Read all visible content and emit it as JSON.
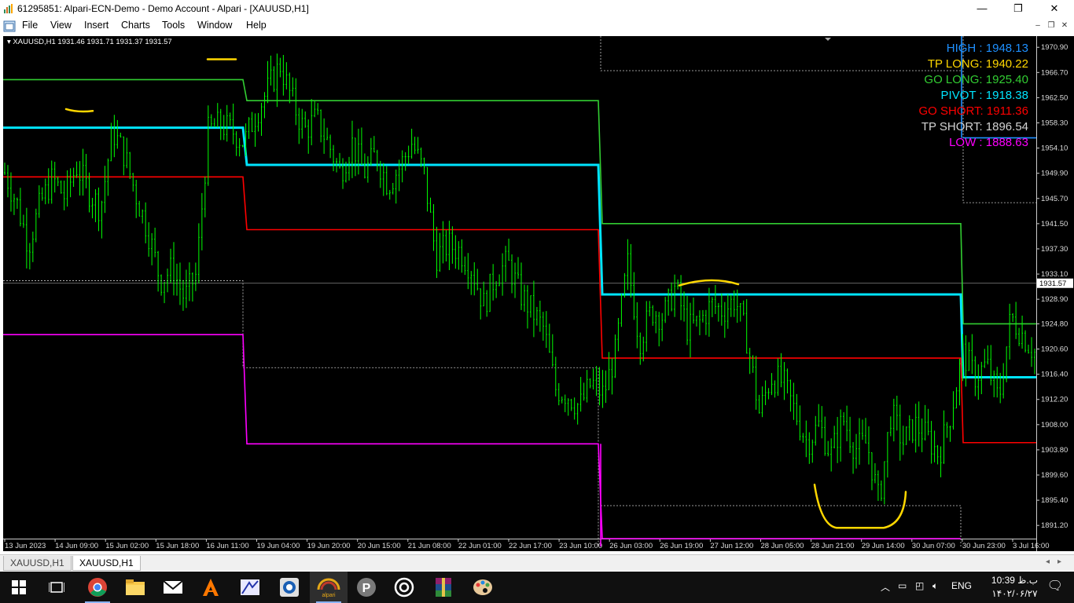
{
  "window": {
    "title": "61295851: Alpari-ECN-Demo - Demo Account - Alpari - [XAUUSD,H1]",
    "minimize": "—",
    "maximize": "❐",
    "close": "✕"
  },
  "menu": {
    "items": [
      "File",
      "View",
      "Insert",
      "Charts",
      "Tools",
      "Window",
      "Help"
    ]
  },
  "chart": {
    "header": "XAUUSD,H1  1931.46 1931.71 1931.37 1931.57",
    "current_price": "1931.57",
    "background": "#000000",
    "candle_color": "#00ff00"
  },
  "info_panel": [
    {
      "label": "HIGH : 1948.13",
      "color": "#1e90ff"
    },
    {
      "label": "TP LONG: 1940.22",
      "color": "#ffd700"
    },
    {
      "label": "GO LONG: 1925.40",
      "color": "#32cd32"
    },
    {
      "label": "PIVOT : 1918.38",
      "color": "#00e5ff"
    },
    {
      "label": "GO SHORT: 1911.36",
      "color": "#ff0000"
    },
    {
      "label": "TP SHORT: 1896.54",
      "color": "#d3d3d3"
    },
    {
      "label": "LOW : 1888.63",
      "color": "#ff00ff"
    }
  ],
  "chart_data": {
    "type": "candlestick",
    "symbol": "XAUUSD",
    "timeframe": "H1",
    "ylim": [
      1889.0,
      1972.5
    ],
    "y_ticks": [
      1970.9,
      1966.7,
      1962.5,
      1958.3,
      1954.1,
      1949.9,
      1945.7,
      1941.5,
      1937.3,
      1933.1,
      1928.9,
      1924.8,
      1920.6,
      1916.4,
      1912.2,
      1908.0,
      1903.8,
      1899.6,
      1895.4,
      1891.2
    ],
    "y_tick_labels": [
      "1970.90",
      "1966.70",
      "1962.50",
      "1958.30",
      "1954.10",
      "1949.90",
      "1945.70",
      "1941.50",
      "1937.30",
      "1933.10",
      "1928.90",
      "1924.80",
      "1920.60",
      "1916.40",
      "1912.20",
      "1908.00",
      "1903.80",
      "1899.60",
      "1895.40",
      "1891.20"
    ],
    "x_tick_labels": [
      "13 Jun 2023",
      "14 Jun 09:00",
      "15 Jun 02:00",
      "15 Jun 18:00",
      "16 Jun 11:00",
      "19 Jun 04:00",
      "19 Jun 20:00",
      "20 Jun 15:00",
      "21 Jun 08:00",
      "22 Jun 01:00",
      "22 Jun 17:00",
      "23 Jun 10:00",
      "26 Jun 03:00",
      "26 Jun 19:00",
      "27 Jun 12:00",
      "28 Jun 05:00",
      "28 Jun 21:00",
      "29 Jun 14:00",
      "30 Jun 07:00",
      "30 Jun 23:00",
      "3 Jul 16:00"
    ],
    "price_path": [
      1950,
      1945,
      1938,
      1945,
      1949,
      1946,
      1951,
      1947,
      1944,
      1957,
      1953,
      1946,
      1940,
      1932,
      1934,
      1929,
      1933,
      1957,
      1958,
      1957,
      1955,
      1960,
      1964,
      1968,
      1962,
      1957,
      1959,
      1955,
      1950,
      1955,
      1950,
      1953,
      1948,
      1951,
      1955,
      1950,
      1936,
      1938,
      1937,
      1934,
      1928,
      1933,
      1935,
      1930,
      1927,
      1924,
      1914,
      1913,
      1911,
      1915,
      1913,
      1920,
      1935,
      1922,
      1927,
      1926,
      1931,
      1924,
      1925,
      1928,
      1927,
      1929,
      1922,
      1910,
      1916,
      1915,
      1910,
      1905,
      1908,
      1903,
      1909,
      1904,
      1905,
      1895,
      1910,
      1905,
      1908,
      1906,
      1903,
      1910,
      1920,
      1916,
      1918,
      1912,
      1926,
      1923,
      1920
    ]
  },
  "tabs": [
    "XAUUSD,H1",
    "XAUUSD,H1"
  ],
  "taskbar": {
    "apps": [
      "start-icon",
      "task-view-icon",
      "chrome-icon",
      "file-explorer-icon",
      "mail-icon",
      "avast-icon",
      "app-icon",
      "app-icon-2",
      "alpari-icon",
      "psiphon-icon",
      "app-icon-3",
      "winrar-icon",
      "paint-icon"
    ],
    "lang": "ENG",
    "time": "10:39 ب.ظ",
    "date": "۱۴۰۲/۰۶/۲۷"
  }
}
